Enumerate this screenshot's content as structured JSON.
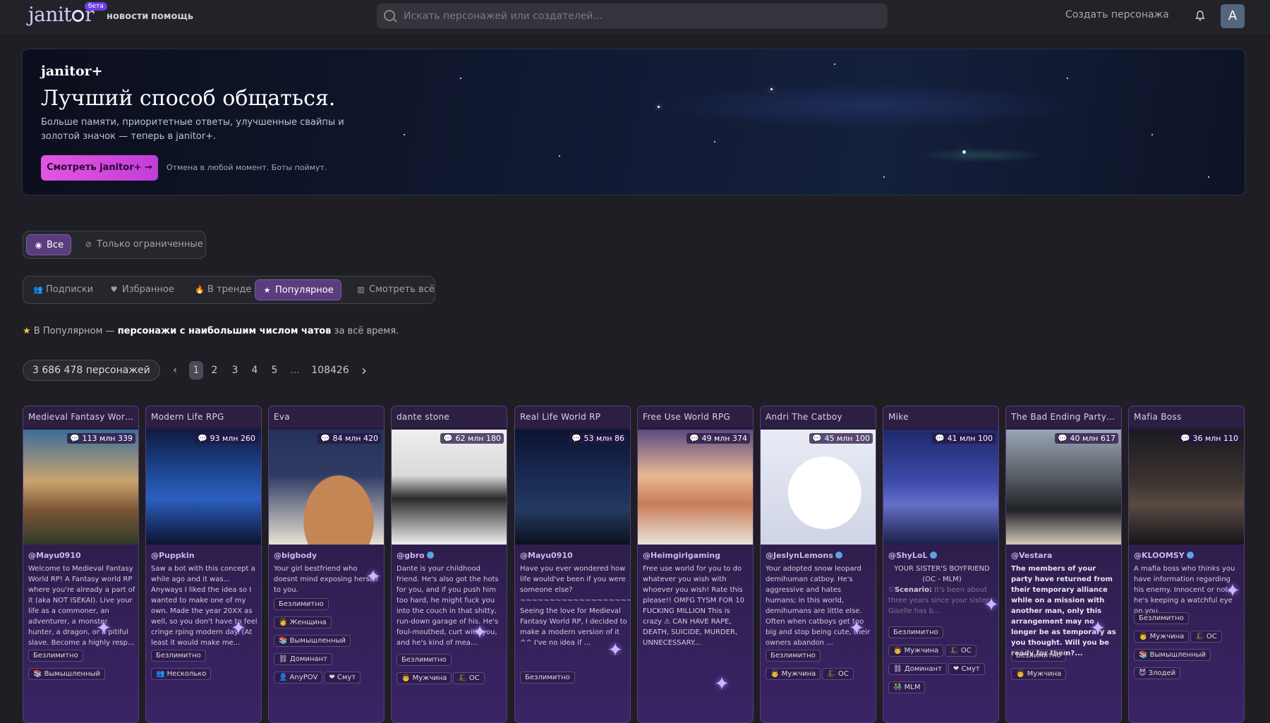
{
  "topbar": {
    "logo": "janitor",
    "beta": "бета",
    "nav": [
      "новости",
      "помощь"
    ],
    "search_placeholder": "Искать персонажей или создателей...",
    "create_label": "Создать персонажа",
    "avatar_letter": "A"
  },
  "hero": {
    "brand": "janitor+",
    "title": "Лучший способ общаться.",
    "description": "Больше памяти, приоритетные ответы, улучшенные свайпы и золотой значок — теперь в janitor+.",
    "cta": "Смотреть janitor+ →",
    "note": "Отмена в любой момент. Боты поймут."
  },
  "content_filter": {
    "all": "Все",
    "limited": "Только ограниченные",
    "active": "all"
  },
  "sort_tabs": {
    "subscriptions": "Подписки",
    "favorites": "Избранное",
    "trending": "В тренде",
    "popular": "Популярное",
    "view_all": "Смотреть всё",
    "active": "popular"
  },
  "info": {
    "prefix": "В Популярном —",
    "highlight": "персонажи с наибольшим числом чатов",
    "suffix": "за всё время."
  },
  "pagination": {
    "total": "3 686 478 персонажей",
    "pages": [
      "1",
      "2",
      "3",
      "4",
      "5",
      "...",
      "108426"
    ],
    "current": "1"
  },
  "cards": [
    {
      "name": "Medieval Fantasy Worl...",
      "stats": "113 млн  339",
      "author": "@Mayu0910",
      "desc": "Welcome to Medieval Fantasy World RP! A Fantasy world RP where you're already a part of it (aka NOT ISEKAI). Live your life as a commoner, an adventurer, a monster hunter, a dragon, or a pitiful slave. Become a highly resp...",
      "tags": [
        "Безлимитно",
        "Вымышленный"
      ]
    },
    {
      "name": "Modern Life RPG",
      "stats": "93 млн  260",
      "author": "@Puppkin",
      "desc": "Saw a bot with this concept a while ago and it was... Anyways I liked the idea so I wanted to make one of my own. Made the year 20XX as well, so you don't have to feel cringe rping modern day. (At least it would make me...",
      "tags": [
        "Безлимитно",
        "Несколько"
      ]
    },
    {
      "name": "Eva",
      "stats": "84 млн  420",
      "author": "@bigbody",
      "desc": "Your girl bestfriend who doesnt mind exposing herself to you.",
      "tags": [
        "Безлимитно",
        "Женщина",
        "Вымышленный",
        "Доминант",
        "AnyPOV",
        "Смут"
      ]
    },
    {
      "name": "dante stone",
      "stats": "62 млн  180",
      "author": "@gbro",
      "desc": "Dante is your childhood friend. He's also got the hots for you, and if you push him too hard, he might fuck you into the couch in that shitty, run-down garage of his. He's foul-mouthed, curt with you, and he's kind of mea...",
      "tags": [
        "Безлимитно",
        "Мужчина",
        "OC"
      ]
    },
    {
      "name": "Real Life World RP",
      "stats": "53 млн  86",
      "author": "@Mayu0910",
      "desc": "Have you ever wondered how life would've been if you were someone else? ~~~~~~~~~~~~~~~~~~~~ Seeing the love for Medieval Fantasy World RP, I decided to make a modern version of it ^^ I've no idea if ...",
      "tags": [
        "Безлимитно"
      ]
    },
    {
      "name": "Free Use World RPG",
      "stats": "49 млн  374",
      "author": "@Heimgirlgaming",
      "desc": "Free use world for you to do whatever you wish with whoever you wish! Rate this please!! OMFG TYSM FOR 10 FUCKING MILLION This is crazy ⚠ CAN HAVE RAPE, DEATH, SUICIDE, MURDER, UNNECESSARY...",
      "tags": []
    },
    {
      "name": "Andri The Catboy",
      "stats": "45 млн  100",
      "author": "@JeslynLemons",
      "desc": "Your adopted snow leopard demihuman catboy. He's aggressive and hates humans; in this world, demihumans are little else. Often when catboys get too big and stop being cute, their owners abandon ...",
      "tags": [
        "Безлимитно",
        "Мужчина",
        "OC"
      ]
    },
    {
      "name": "Mike",
      "stats": "41 млн  100",
      "author": "@ShyLoL",
      "desc_title": "YOUR SISTER'S BOYFRIEND (OC - MLM)",
      "desc_label": "Scenario:",
      "desc": "It's been about three years since your sister Giselle has b...",
      "tags": [
        "Безлимитно",
        "Мужчина",
        "OC",
        "Доминант",
        "Смут",
        "MLM"
      ]
    },
    {
      "name": "The Bad Ending Party ...",
      "stats": "40 млн  617",
      "author": "@Vestara",
      "desc": "The members of your party have returned from their temporary alliance while on a mission with another man, only this arrangement may no longer be as temporary as you thought. Will you be ready for them?...",
      "tags": [
        "Безлимитно",
        "Мужчина"
      ]
    },
    {
      "name": "Mafia Boss",
      "stats": "36 млн  110",
      "author": "@KLOOMSY",
      "desc": "A mafia boss who thinks you have information regarding his enemy. Innocent or not, he's keeping a watchful eye on you.",
      "tags": [
        "Безлимитно",
        "Мужчина",
        "OC",
        "Вымышленный",
        "Злодей"
      ]
    }
  ],
  "colors": {
    "accent": "#5a3d7e",
    "cta": "#e056e0",
    "card_border": "#5a3d7a"
  }
}
